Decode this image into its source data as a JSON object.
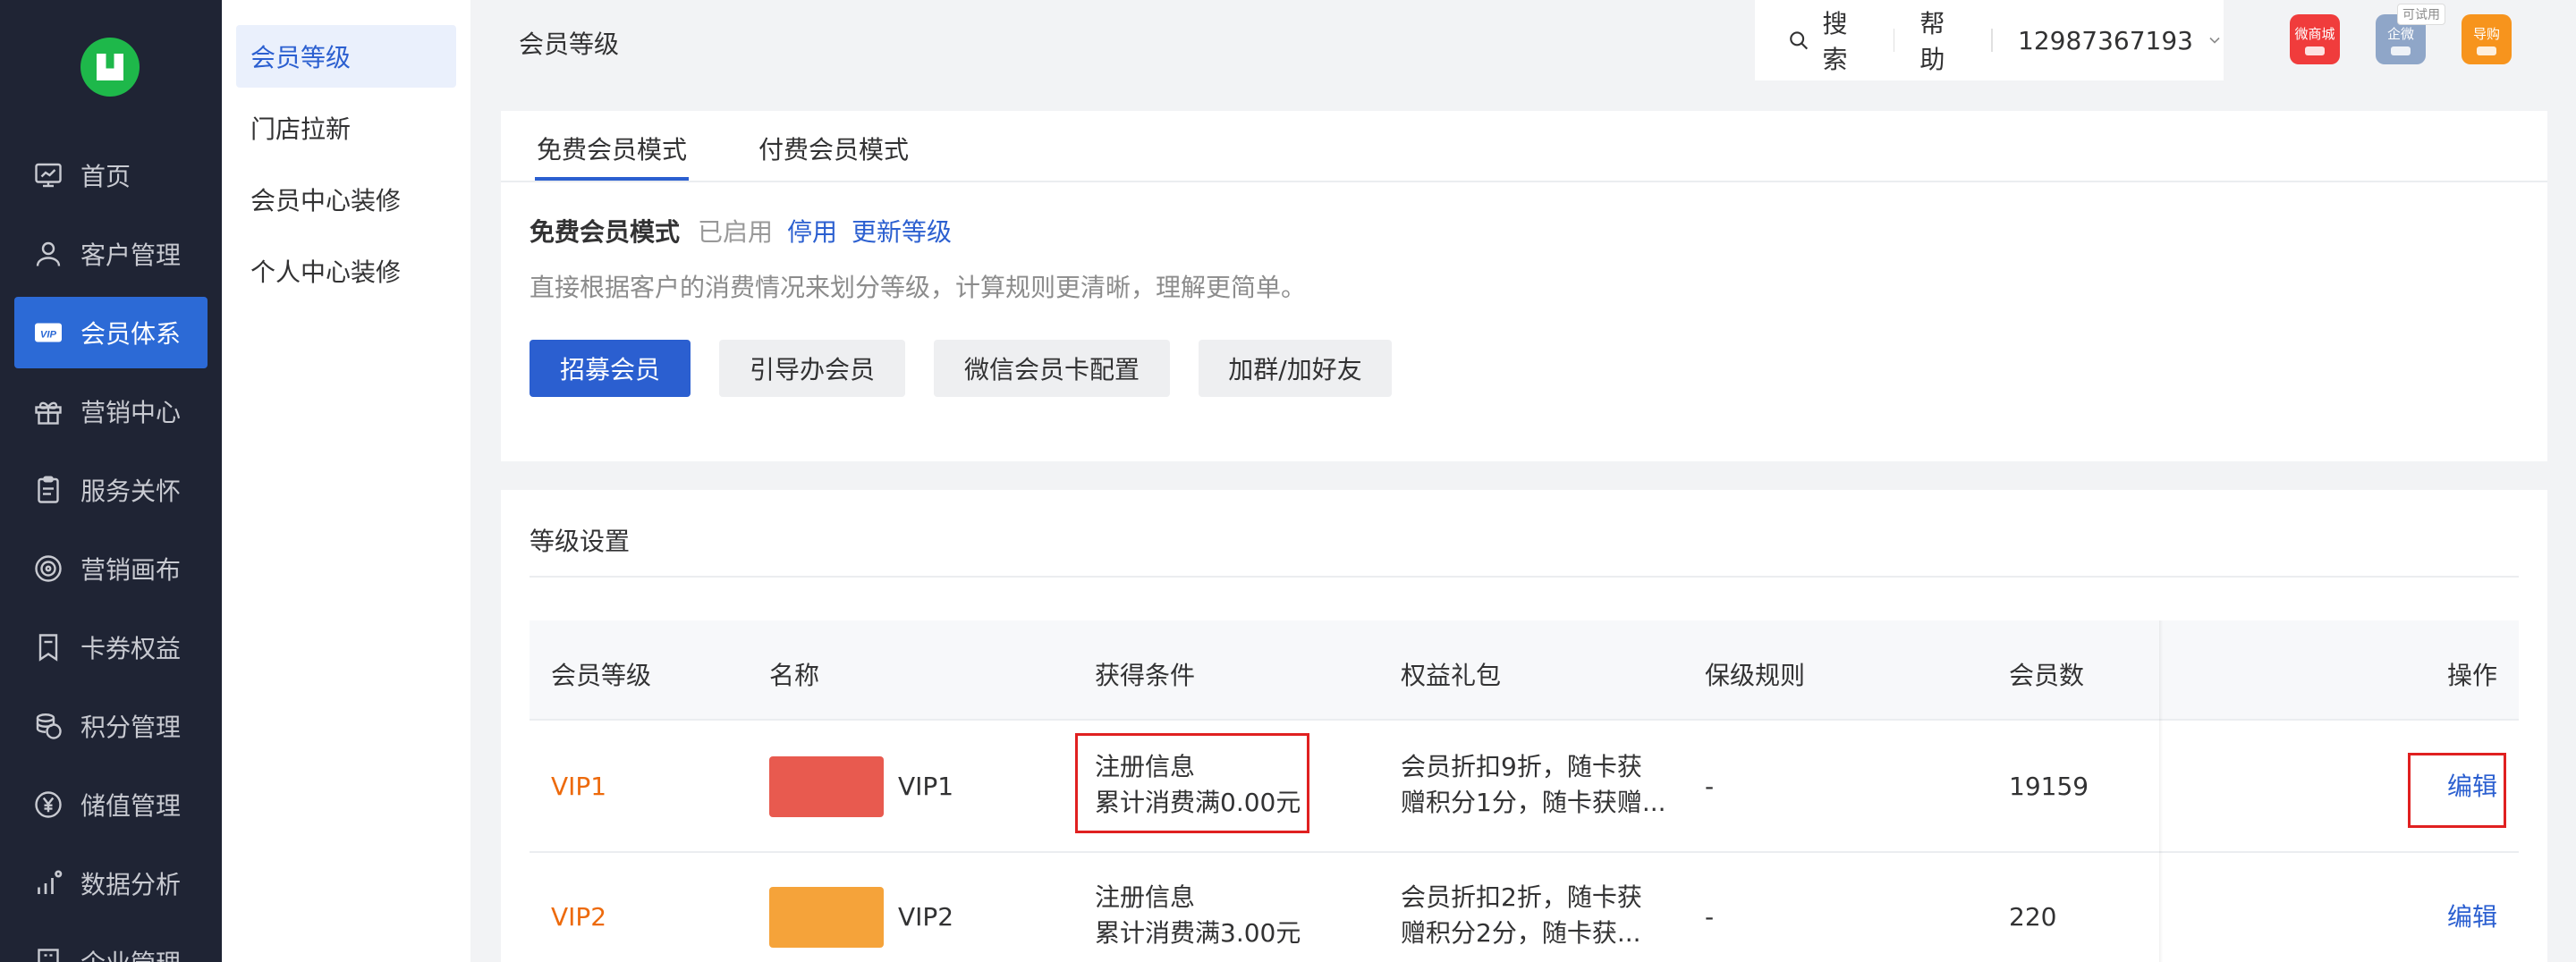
{
  "sidebar": {
    "logo_icon": "logo-icon",
    "items": [
      {
        "label": "首页",
        "icon": "dashboard-icon",
        "active": false
      },
      {
        "label": "客户管理",
        "icon": "user-icon",
        "active": false
      },
      {
        "label": "会员体系",
        "icon": "vip-icon",
        "active": true
      },
      {
        "label": "营销中心",
        "icon": "gift-icon",
        "active": false
      },
      {
        "label": "服务关怀",
        "icon": "clipboard-icon",
        "active": false
      },
      {
        "label": "营销画布",
        "icon": "target-icon",
        "active": false
      },
      {
        "label": "卡券权益",
        "icon": "coupon-icon",
        "active": false
      },
      {
        "label": "积分管理",
        "icon": "coins-icon",
        "active": false
      },
      {
        "label": "储值管理",
        "icon": "yen-icon",
        "active": false
      },
      {
        "label": "数据分析",
        "icon": "bar-chart-icon",
        "active": false
      },
      {
        "label": "企业管理",
        "icon": "building-icon",
        "active": false
      }
    ],
    "accent_color": "#2c6ad6",
    "background": "#1f2434"
  },
  "subnav": {
    "items": [
      {
        "label": "会员等级",
        "active": true
      },
      {
        "label": "门店拉新",
        "active": false
      },
      {
        "label": "会员中心装修",
        "active": false
      },
      {
        "label": "个人中心装修",
        "active": false
      }
    ]
  },
  "header": {
    "title": "会员等级",
    "search_label": "搜索",
    "help_label": "帮助",
    "phone": "12987367193",
    "apps": [
      {
        "label": "微商城",
        "color": "#f03c3c",
        "icon": "shop-app-icon"
      },
      {
        "label": "企微",
        "color": "#8fa6c8",
        "icon": "wecom-app-icon"
      },
      {
        "label": "导购",
        "color": "#f7941d",
        "icon": "guide-app-icon"
      }
    ],
    "trial_tag": "可试用"
  },
  "mode_card": {
    "tabs": [
      {
        "label": "免费会员模式",
        "active": true
      },
      {
        "label": "付费会员模式",
        "active": false
      }
    ],
    "mode_name": "免费会员模式",
    "mode_status": "已启用",
    "disable_link": "停用",
    "update_link": "更新等级",
    "description": "直接根据客户的消费情况来划分等级，计算规则更清晰，理解更简单。",
    "buttons": {
      "recruit": "招募会员",
      "guide": "引导办会员",
      "wechat_card": "微信会员卡配置",
      "group": "加群/加好友"
    }
  },
  "level_card": {
    "title": "等级设置",
    "columns": [
      "会员等级",
      "名称",
      "获得条件",
      "权益礼包",
      "保级规则",
      "会员数",
      "操作"
    ],
    "rows": [
      {
        "level": "VIP1",
        "swatch_color": "#e85a4f",
        "name": "VIP1",
        "condition_line1": "注册信息",
        "condition_line2": "累计消费满0.00元",
        "benefit_line1": "会员折扣9折，随卡获",
        "benefit_line2": "赠积分1分，随卡获赠...",
        "keep_rule": "-",
        "members": "19159",
        "action": "编辑"
      },
      {
        "level": "VIP2",
        "swatch_color": "#f5a33a",
        "name": "VIP2",
        "condition_line1": "注册信息",
        "condition_line2": "累计消费满3.00元",
        "benefit_line1": "会员折扣2折，随卡获",
        "benefit_line2": "赠积分2分，随卡获...",
        "keep_rule": "-",
        "members": "220",
        "action": "编辑"
      }
    ]
  }
}
